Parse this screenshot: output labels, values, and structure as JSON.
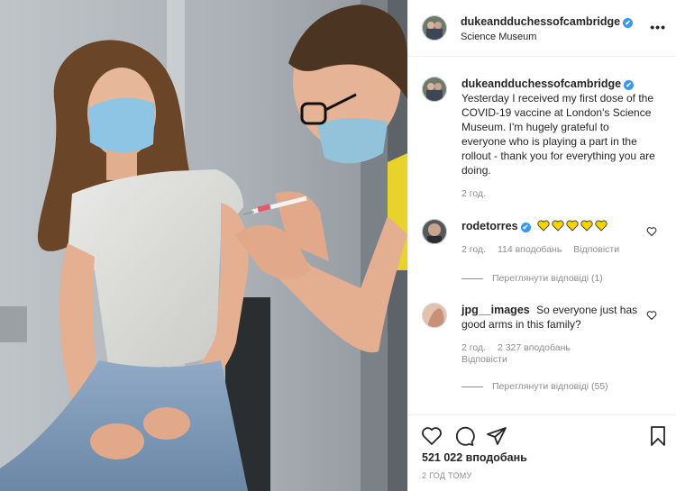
{
  "post": {
    "username": "dukeandduchessofcambridge",
    "location": "Science Museum",
    "caption": "Yesterday I received my first dose of the COVID-19 vaccine at London's Science Museum. I'm hugely grateful to everyone who is playing a part in the rollout - thank you for everything you are doing.",
    "caption_time": "2 год.",
    "verified_icon": "✔",
    "more_icon": "•••"
  },
  "comments": [
    {
      "username": "rodetorres",
      "verified": true,
      "text": "",
      "emoji": "yellow-heart x5",
      "time": "2 год.",
      "likes": "114 вподобань",
      "reply_label": "Відповісти",
      "view_replies": "Переглянути відповіді (1)"
    },
    {
      "username": "jpg__images",
      "verified": false,
      "text": "So everyone just has good arms in this family?",
      "time": "2 год.",
      "likes": "2 327 вподобань",
      "reply_label": "Відповісти",
      "view_replies": "Переглянути відповіді (55)"
    }
  ],
  "footer": {
    "likes": "521 022 вподобань",
    "time_ago": "2 ГОД ТОМУ"
  },
  "colors": {
    "verified": "#3897f0",
    "muted": "#8e8e8e",
    "text": "#262626",
    "emoji_heart": "#f5d300"
  }
}
